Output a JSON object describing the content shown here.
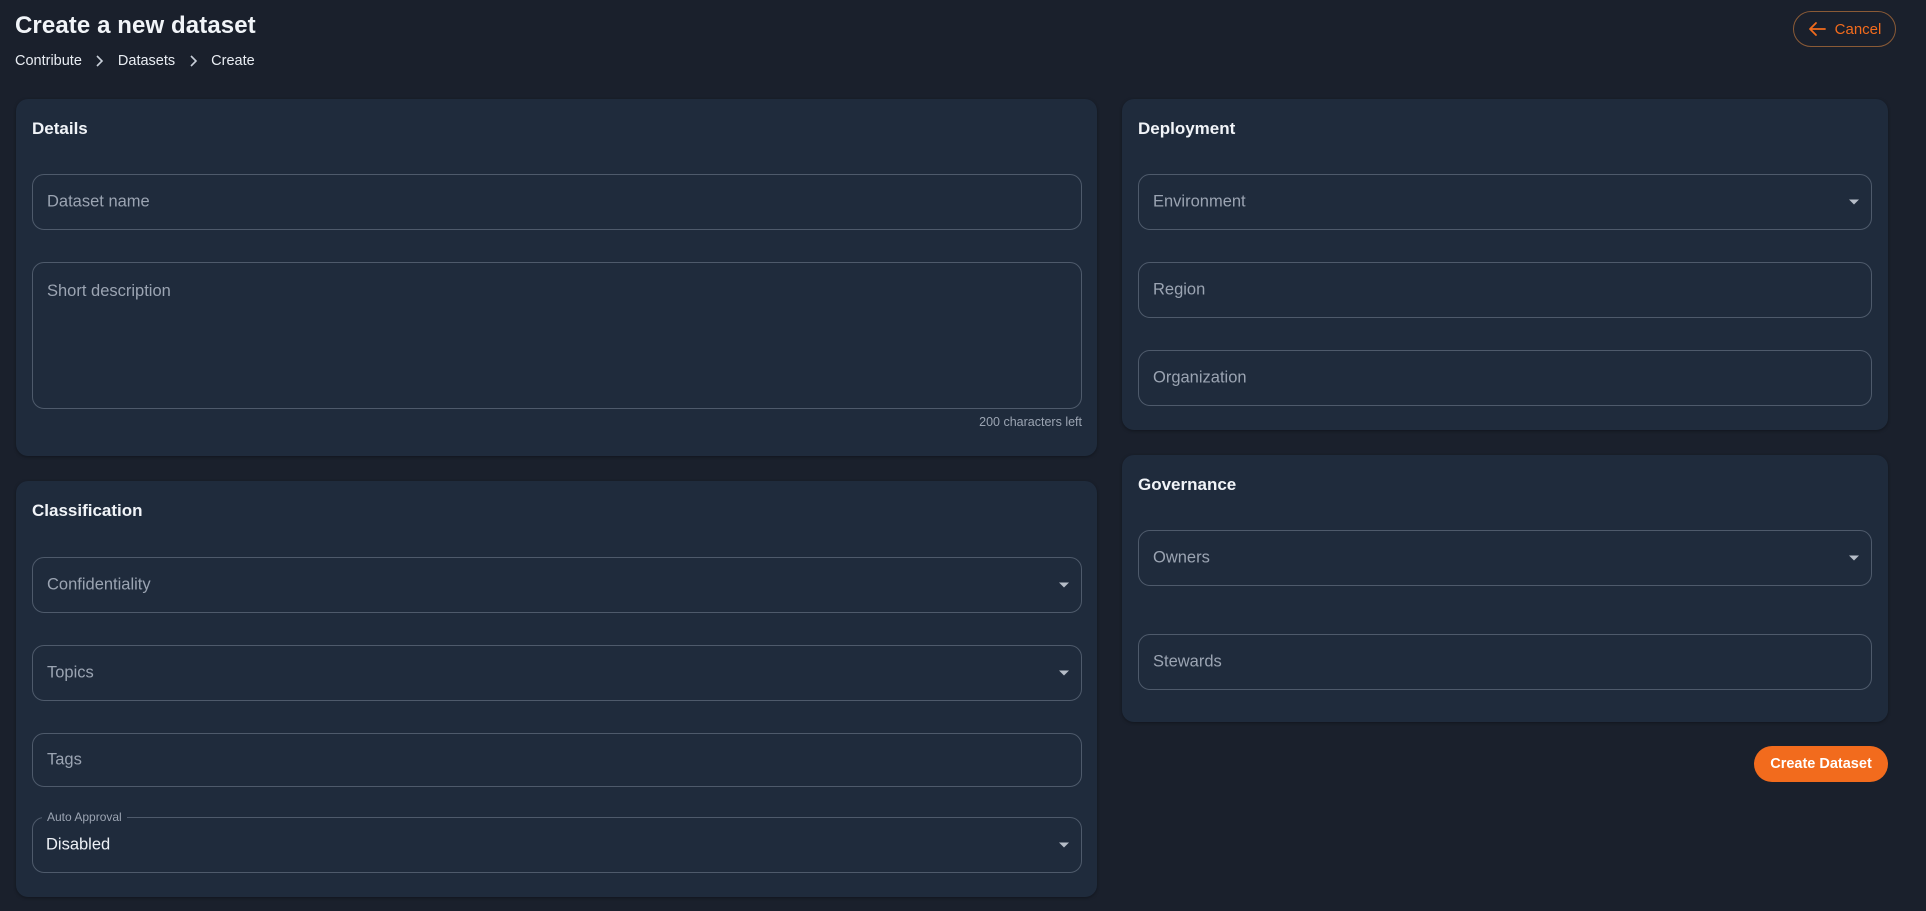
{
  "header": {
    "title": "Create a new dataset",
    "breadcrumb": [
      "Contribute",
      "Datasets",
      "Create"
    ],
    "cancel_label": "Cancel"
  },
  "details": {
    "title": "Details",
    "dataset_name_placeholder": "Dataset name",
    "description_placeholder": "Short description",
    "characters_left": "200 characters left"
  },
  "classification": {
    "title": "Classification",
    "confidentiality_placeholder": "Confidentiality",
    "topics_placeholder": "Topics",
    "tags_placeholder": "Tags",
    "auto_approval_label": "Auto Approval",
    "auto_approval_value": "Disabled"
  },
  "deployment": {
    "title": "Deployment",
    "environment_placeholder": "Environment",
    "region_placeholder": "Region",
    "organization_placeholder": "Organization"
  },
  "governance": {
    "title": "Governance",
    "owners_placeholder": "Owners",
    "stewards_placeholder": "Stewards"
  },
  "actions": {
    "create_label": "Create Dataset"
  },
  "colors": {
    "background": "#1a202c",
    "card": "#1f2b3c",
    "accent": "#f26b1d"
  },
  "icons": {
    "cancel": "arrow-left-icon",
    "breadcrumb_separator": "chevron-right-icon",
    "select": "caret-down-icon"
  }
}
